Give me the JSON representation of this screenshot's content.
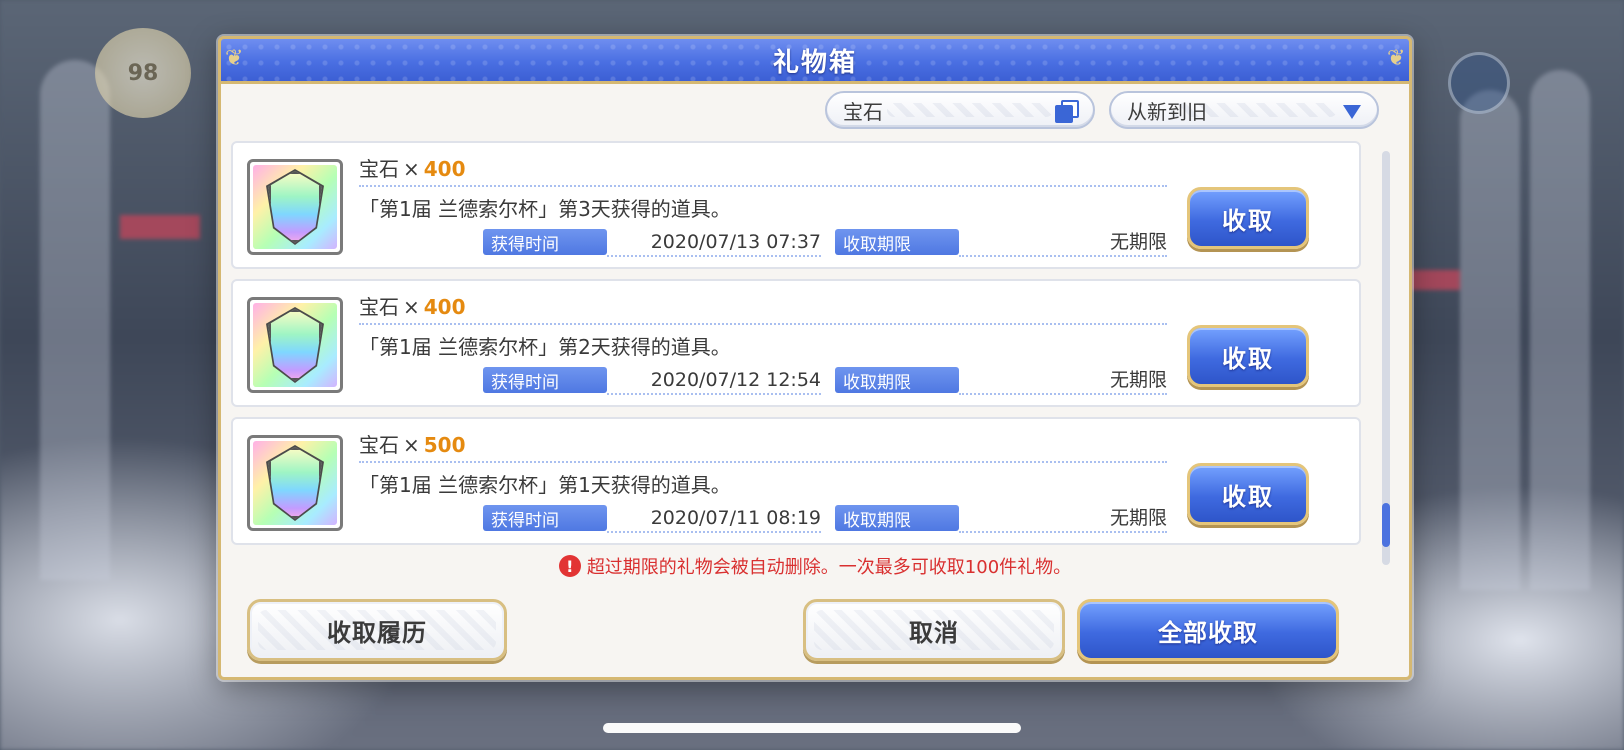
{
  "dialog": {
    "title": "礼物箱",
    "type_filter": {
      "label": "宝石",
      "icon": "copy-icon"
    },
    "sort_filter": {
      "label": "从新到旧",
      "icon": "chevron-down-icon"
    },
    "notice": {
      "icon": "warning-icon",
      "text": "超过期限的礼物会被自动删除。一次最多可收取100件礼物。"
    },
    "buttons": {
      "history": "收取履历",
      "cancel": "取消",
      "claim_all": "全部收取"
    },
    "items": [
      {
        "name": "宝石",
        "times": "×",
        "qty": "400",
        "desc": "「第1届 兰德索尔杯」第3天获得的道具。",
        "obtained_label": "获得时间",
        "obtained": "2020/07/13 07:37",
        "deadline_label": "收取期限",
        "deadline": "无期限",
        "claim": "收取"
      },
      {
        "name": "宝石",
        "times": "×",
        "qty": "400",
        "desc": "「第1届 兰德索尔杯」第2天获得的道具。",
        "obtained_label": "获得时间",
        "obtained": "2020/07/12 12:54",
        "deadline_label": "收取期限",
        "deadline": "无期限",
        "claim": "收取"
      },
      {
        "name": "宝石",
        "times": "×",
        "qty": "500",
        "desc": "「第1届 兰德索尔杯」第1天获得的道具。",
        "obtained_label": "获得时间",
        "obtained": "2020/07/11 08:19",
        "deadline_label": "收取期限",
        "deadline": "无期限",
        "claim": "收取"
      }
    ],
    "scroll_position": 0.95
  },
  "hud": {
    "level": "98"
  },
  "colors": {
    "header_blue": "#4a6fe2",
    "accent_gold": "#d5b872",
    "qty_orange": "#e58a10",
    "notice_red": "#d93030"
  }
}
